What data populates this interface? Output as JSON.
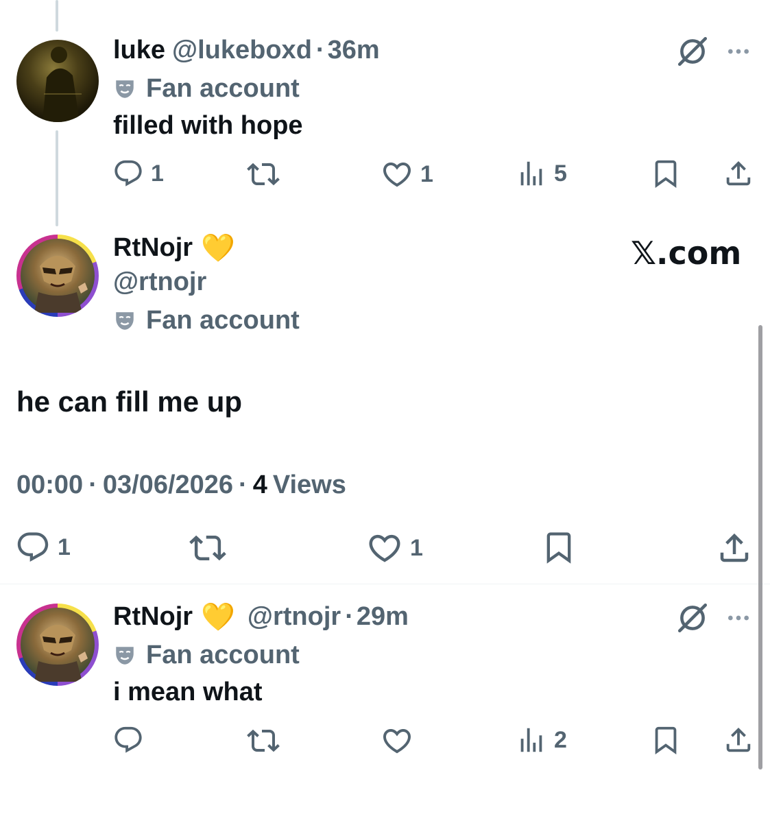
{
  "tweets": [
    {
      "display_name": "luke",
      "handle": "@lukeboxd",
      "time": "36m",
      "fan_label": "Fan account",
      "text": "filled with hope",
      "replies": "1",
      "likes": "1",
      "views": "5"
    },
    {
      "display_name": "RtNojr",
      "badge_emoji": "💛",
      "handle": "@rtnojr",
      "fan_label": "Fan account",
      "text": "he can fill me up",
      "time": "00:00",
      "date": "03/06/2026",
      "views_count": "4",
      "views_label": "Views",
      "replies": "1",
      "likes": "1"
    },
    {
      "display_name": "RtNojr",
      "badge_emoji": "💛",
      "handle": "@rtnojr",
      "time": "29m",
      "fan_label": "Fan account",
      "text": "i mean what",
      "views": "2"
    }
  ],
  "watermark": "𝕏.com",
  "separator": "·",
  "icons": [
    "reply-icon",
    "retweet-icon",
    "like-icon",
    "views-icon",
    "bookmark-icon",
    "share-icon",
    "grok-icon",
    "more-icon",
    "fan-mask-icon"
  ],
  "colors": {
    "text": "#0f1419",
    "muted": "#536471",
    "line": "#cfd9de",
    "gold": "#f8c23c"
  }
}
